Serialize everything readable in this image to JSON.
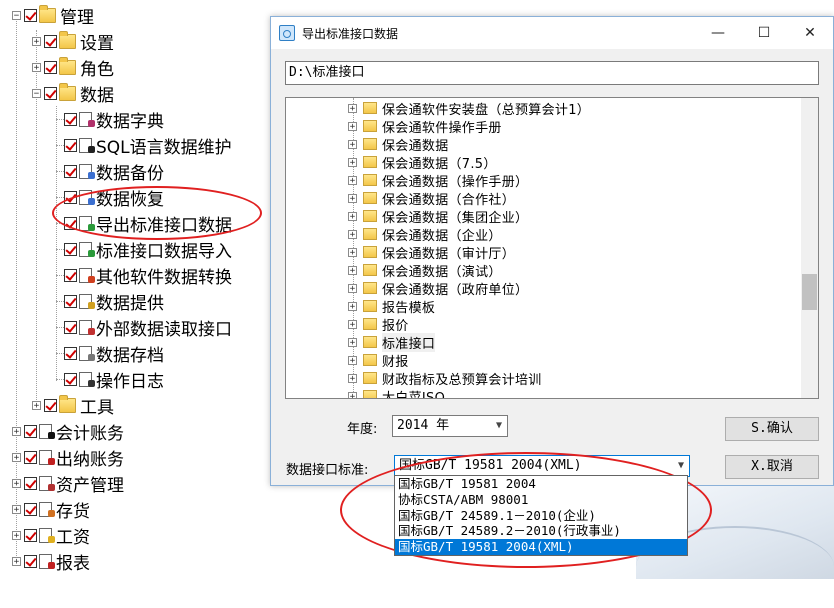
{
  "tree": {
    "items": [
      {
        "label": "管理",
        "level": 0,
        "expander": "-",
        "icon": "folder-open-icon"
      },
      {
        "label": "设置",
        "level": 1,
        "expander": "+",
        "icon": "folder-icon"
      },
      {
        "label": "角色",
        "level": 1,
        "expander": "+",
        "icon": "folder-icon"
      },
      {
        "label": "数据",
        "level": 1,
        "expander": "-",
        "icon": "folder-open-icon"
      },
      {
        "label": "数据字典",
        "level": 2,
        "icon": "book-icon"
      },
      {
        "label": "SQL语言数据维护",
        "level": 2,
        "icon": "sql-icon"
      },
      {
        "label": "数据备份",
        "level": 2,
        "icon": "backup-icon"
      },
      {
        "label": "数据恢复",
        "level": 2,
        "icon": "restore-icon"
      },
      {
        "label": "导出标准接口数据",
        "level": 2,
        "icon": "export-icon"
      },
      {
        "label": "标准接口数据导入",
        "level": 2,
        "icon": "import-icon"
      },
      {
        "label": "其他软件数据转换",
        "level": 2,
        "icon": "convert-icon"
      },
      {
        "label": "数据提供",
        "level": 2,
        "icon": "provide-icon"
      },
      {
        "label": "外部数据读取接口",
        "level": 2,
        "icon": "external-icon"
      },
      {
        "label": "数据存档",
        "level": 2,
        "icon": "archive-icon"
      },
      {
        "label": "操作日志",
        "level": 2,
        "icon": "eye-icon"
      },
      {
        "label": "工具",
        "level": 1,
        "expander": "+",
        "icon": "folder-icon"
      },
      {
        "label": "会计账务",
        "level": 0,
        "expander": "+",
        "icon": "yinyang-icon"
      },
      {
        "label": "出纳账务",
        "level": 0,
        "expander": "+",
        "icon": "cashier-icon"
      },
      {
        "label": "资产管理",
        "level": 0,
        "expander": "+",
        "icon": "asset-icon"
      },
      {
        "label": "存货",
        "level": 0,
        "expander": "+",
        "icon": "inventory-icon"
      },
      {
        "label": "工资",
        "level": 0,
        "expander": "+",
        "icon": "salary-icon"
      },
      {
        "label": "报表",
        "level": 0,
        "expander": "+",
        "icon": "report-icon"
      }
    ]
  },
  "dialog": {
    "title": "导出标准接口数据",
    "minimize": "—",
    "maximize": "☐",
    "close": "✕",
    "path": "D:\\标准接口",
    "folders": [
      "保会通软件安装盘（总预算会计1）",
      "保会通软件操作手册",
      "保会通数据",
      "保会通数据（7.5）",
      "保会通数据（操作手册）",
      "保会通数据（合作社）",
      "保会通数据（集团企业）",
      "保会通数据（企业）",
      "保会通数据（审计厅）",
      "保会通数据（演试）",
      "保会通数据（政府单位）",
      "报告模板",
      "报价",
      "标准接口",
      "财报",
      "财政指标及总预算会计培训",
      "大白菜ISO"
    ],
    "current_folder": "标准接口",
    "year_label": "年度:",
    "year_value": "2014 年",
    "standard_label": "数据接口标准:",
    "standard_value": "国标GB/T 19581 2004(XML)",
    "confirm_button": "S.确认",
    "cancel_button": "X.取消",
    "dropdown_options": [
      "国标GB/T 19581 2004",
      "协标CSTA/ABM 98001",
      "国标GB/T 24589.1－2010(企业)",
      "国标GB/T 24589.2－2010(行政事业)",
      "国标GB/T 19581 2004(XML)"
    ],
    "dropdown_highlighted": 4
  },
  "colors": {
    "accent": "#0078d7",
    "check": "#d00000",
    "annotation": "#e02020"
  }
}
